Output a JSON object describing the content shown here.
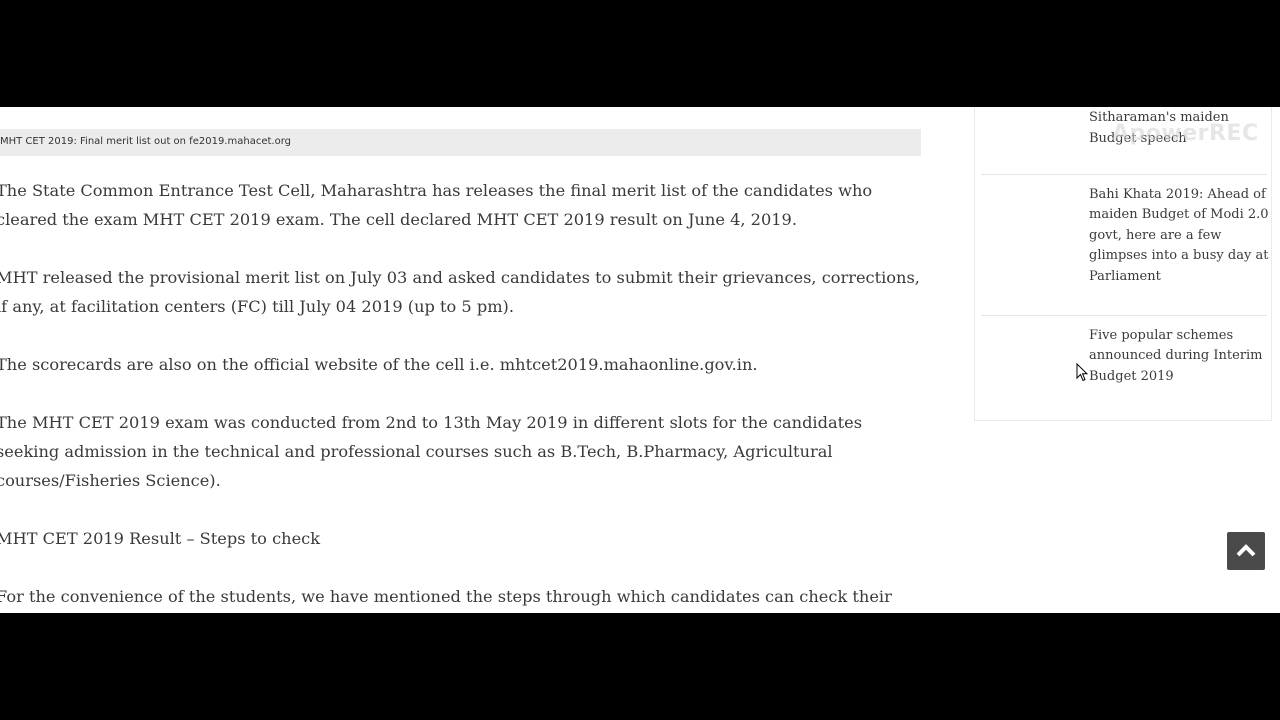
{
  "article": {
    "caption": "MHT CET 2019: Final merit list out on fe2019.mahacet.org",
    "paragraphs": [
      "The State Common Entrance Test Cell, Maharashtra has releases the final merit list of the candidates who cleared the exam MHT CET 2019 exam. The cell declared MHT CET 2019 result on June 4, 2019.",
      "MHT released the provisional merit list on July 03 and asked candidates to submit their grievances, corrections, if any, at facilitation centers (FC) till July 04 2019 (up to 5 pm).",
      "The scorecards are also on the official website of the cell i.e. mhtcet2019.mahaonline.gov.in.",
      "The MHT CET 2019 exam was conducted from 2nd to 13th May 2019 in different slots for the candidates seeking admission in the technical and professional courses such as B.Tech, B.Pharmacy, Agricultural courses/Fisheries Science).",
      "MHT CET 2019 Result – Steps to check",
      "For the convenience of the students, we have mentioned the steps through which candidates can check their MHT"
    ]
  },
  "sidebar": {
    "items": [
      {
        "title": "takeaways of FM Nirmala Sitharaman's maiden Budget speech"
      },
      {
        "title": "Bahi Khata 2019: Ahead of maiden Budget of Modi 2.0 govt, here are a few glimpses into a busy day at Parliament"
      },
      {
        "title": "Five popular schemes announced during Interim Budget 2019"
      }
    ]
  },
  "watermark": "ApowerREC",
  "icons": {
    "back_to_top": "chevron-up-icon",
    "cursor": "mouse-pointer-icon"
  },
  "colors": {
    "text": "#3a3a3a",
    "caption_bg": "#ececec",
    "back_to_top_bg": "#4a4a4a",
    "frame": "#000000"
  }
}
